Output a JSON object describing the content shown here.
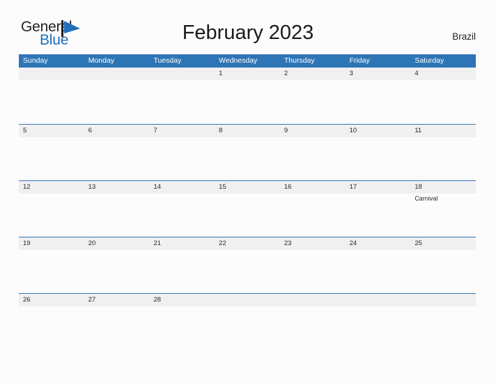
{
  "brand": {
    "word_one": "General",
    "word_two": "Blue",
    "mark": "flag-triangle-icon",
    "color_dark": "#231f20",
    "color_blue": "#1e6fba"
  },
  "header": {
    "title": "February 2023",
    "region": "Brazil"
  },
  "theme": {
    "header_blue": "#2e75b6",
    "band_gray": "#f0f0f0",
    "page_background": "#fcfcfd",
    "text_dark": "#262626"
  },
  "calendar": {
    "month": "February",
    "year": "2023",
    "weekday_headers": [
      "Sunday",
      "Monday",
      "Tuesday",
      "Wednesday",
      "Thursday",
      "Friday",
      "Saturday"
    ],
    "weeks": [
      {
        "days": [
          {
            "number": "",
            "events": []
          },
          {
            "number": "",
            "events": []
          },
          {
            "number": "",
            "events": []
          },
          {
            "number": "1",
            "events": []
          },
          {
            "number": "2",
            "events": []
          },
          {
            "number": "3",
            "events": []
          },
          {
            "number": "4",
            "events": []
          }
        ]
      },
      {
        "days": [
          {
            "number": "5",
            "events": []
          },
          {
            "number": "6",
            "events": []
          },
          {
            "number": "7",
            "events": []
          },
          {
            "number": "8",
            "events": []
          },
          {
            "number": "9",
            "events": []
          },
          {
            "number": "10",
            "events": []
          },
          {
            "number": "11",
            "events": []
          }
        ]
      },
      {
        "days": [
          {
            "number": "12",
            "events": []
          },
          {
            "number": "13",
            "events": []
          },
          {
            "number": "14",
            "events": []
          },
          {
            "number": "15",
            "events": []
          },
          {
            "number": "16",
            "events": []
          },
          {
            "number": "17",
            "events": []
          },
          {
            "number": "18",
            "events": [
              "Carnival"
            ]
          }
        ]
      },
      {
        "days": [
          {
            "number": "19",
            "events": []
          },
          {
            "number": "20",
            "events": []
          },
          {
            "number": "21",
            "events": []
          },
          {
            "number": "22",
            "events": []
          },
          {
            "number": "23",
            "events": []
          },
          {
            "number": "24",
            "events": []
          },
          {
            "number": "25",
            "events": []
          }
        ]
      },
      {
        "days": [
          {
            "number": "26",
            "events": []
          },
          {
            "number": "27",
            "events": []
          },
          {
            "number": "28",
            "events": []
          },
          {
            "number": "",
            "events": []
          },
          {
            "number": "",
            "events": []
          },
          {
            "number": "",
            "events": []
          },
          {
            "number": "",
            "events": []
          }
        ]
      }
    ]
  }
}
